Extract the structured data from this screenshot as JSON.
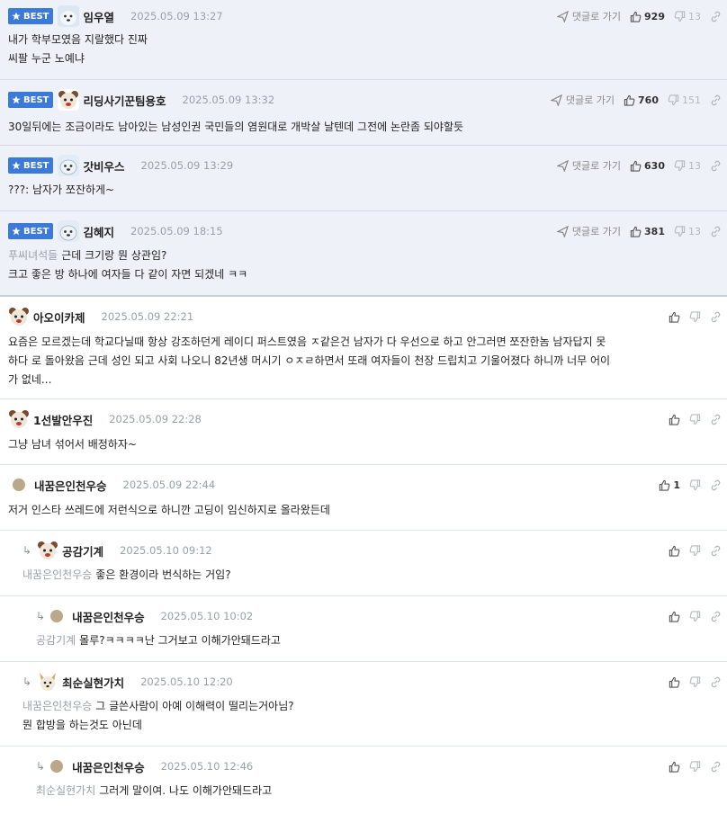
{
  "labels": {
    "best": "BEST",
    "goto_reply": "댓글로 가기"
  },
  "comments": [
    {
      "nick": "임우열",
      "date": "2025.05.09 13:27",
      "likes": "929",
      "dislikes": "13",
      "lines": [
        "내가 학부모였음 지랄했다 진짜",
        "씨팔 누군 노예냐"
      ]
    },
    {
      "nick": "리딩사기꾼팀용호",
      "date": "2025.05.09 13:32",
      "likes": "760",
      "dislikes": "151",
      "lines": [
        "30일뒤에는 조금이라도 남아있는 남성인권 국민들의 염원대로 개박살 날텐데 그전에 논란좀 되야할듯"
      ]
    },
    {
      "nick": "갓비우스",
      "date": "2025.05.09 13:29",
      "likes": "630",
      "dislikes": "13",
      "lines": [
        "???: 남자가 쪼잔하게~"
      ]
    },
    {
      "nick": "김혜지",
      "date": "2025.05.09 18:15",
      "likes": "381",
      "dislikes": "13",
      "mention": "푸씨녀석들",
      "lines": [
        "근데 크기랑 뭔 상관임?",
        "크고 좋은 방 하나에 여자들 다 같이 자면 되겠네 ㅋㅋ"
      ]
    },
    {
      "nick": "아오이카제",
      "date": "2025.05.09 22:21",
      "lines": [
        "요즘은 모르겠는데 학교다닐때 항상 강조하던게 레이디 퍼스트였음 ㅈ같은건 남자가 다 우선으로 하고 안그러면 쪼잔한놈 남자답지 못",
        "하다 로 돌아왔음 근데 성인 되고 사회 나오니 82년생 머시기 ㅇㅈㄹ하면서 또래 여자들이 천장 드립치고 기울어졌다 하니까 너무 어이",
        "가 없네..."
      ]
    },
    {
      "nick": "1선발안우진",
      "date": "2025.05.09 22:28",
      "lines": [
        "그냥 남녀 섞어서 배정하자~"
      ]
    },
    {
      "nick": "내꿈은인천우승",
      "date": "2025.05.09 22:44",
      "likes": "1",
      "lines": [
        "저거 인스타 쓰레드에 저런식으로 하니깐 고딩이 임신하지로 올라왔든데"
      ]
    },
    {
      "nick": "공감기계",
      "date": "2025.05.10 09:12",
      "mention": "내꿈은인천우승",
      "lines": [
        "좋은 환경이라 번식하는 거임?"
      ]
    },
    {
      "nick": "내꿈은인천우승",
      "date": "2025.05.10 10:02",
      "mention": "공감기계",
      "lines": [
        "몰루?ㅋㅋㅋㅋ난 그거보고 이해가안돼드라고"
      ]
    },
    {
      "nick": "최순실현가치",
      "date": "2025.05.10 12:20",
      "mention": "내꿈은인천우승",
      "lines": [
        "그 글쓴사람이 아예 이해력이 떨리는거아님?",
        "뭔 합방을 하는것도 아닌데"
      ]
    },
    {
      "nick": "내꿈은인천우승",
      "date": "2025.05.10 12:46",
      "mention": "최순실현가치",
      "lines": [
        "그러게 말이여. 나도 이해가안돼드라고"
      ]
    }
  ],
  "colors": {
    "best_badge": "#3b7ad9",
    "best_bg": "#eef2f8",
    "muted": "#9aa0a8"
  },
  "icons": {
    "thumb_up": "thumbs-up-icon",
    "thumb_down": "thumbs-down-icon",
    "link": "link-icon",
    "reply_arrow": "reply-arrow-icon",
    "star": "star-icon"
  }
}
